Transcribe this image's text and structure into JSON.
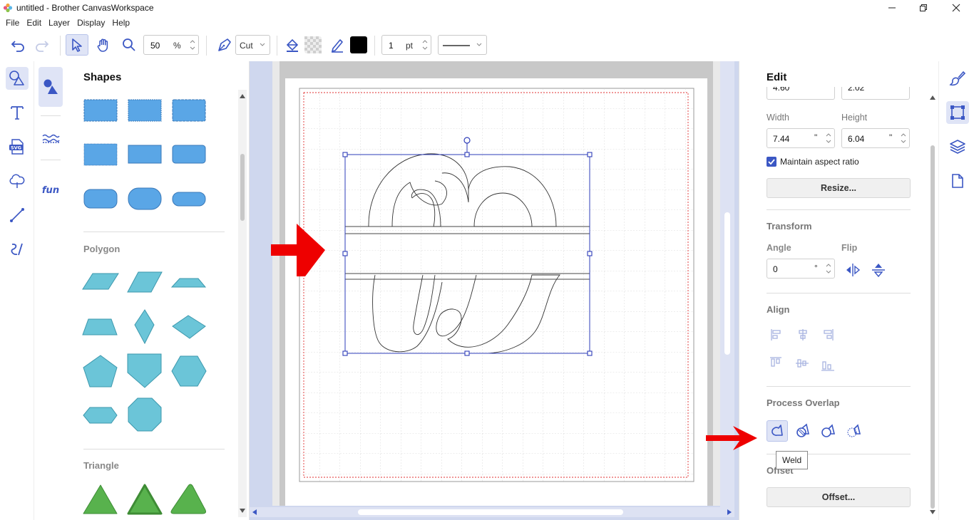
{
  "window": {
    "title": "untitled - Brother CanvasWorkspace"
  },
  "menu": [
    "File",
    "Edit",
    "Layer",
    "Display",
    "Help"
  ],
  "toolbar": {
    "zoom_value": "50",
    "zoom_unit": "%",
    "mode_label": "Cut",
    "line_width_value": "1",
    "line_width_unit": "pt",
    "stroke_color": "#000000"
  },
  "shapes_panel": {
    "title": "Shapes",
    "sections": [
      "Polygon",
      "Triangle"
    ]
  },
  "edit_panel": {
    "title": "Edit",
    "x_partial": "4.60",
    "y_partial": "2.02",
    "width_label": "Width",
    "height_label": "Height",
    "width_value": "7.44",
    "height_value": "6.04",
    "size_unit": "\"",
    "maintain_aspect_label": "Maintain aspect ratio",
    "maintain_aspect_checked": true,
    "resize_button": "Resize...",
    "transform_label": "Transform",
    "angle_label": "Angle",
    "flip_label": "Flip",
    "angle_value": "0",
    "angle_unit": "°",
    "align_label": "Align",
    "process_overlap_label": "Process Overlap",
    "offset_label": "Offset",
    "offset_button": "Offset...",
    "tooltip": "Weld"
  },
  "colors": {
    "accent": "#3b57c4",
    "annotation_arrow": "#ee0000",
    "shape_fill": "#5aa6e6",
    "polygon_fill": "#6bc5d8",
    "triangle_fill": "#58b24d",
    "canvas_bg": "#cfd7ee"
  }
}
